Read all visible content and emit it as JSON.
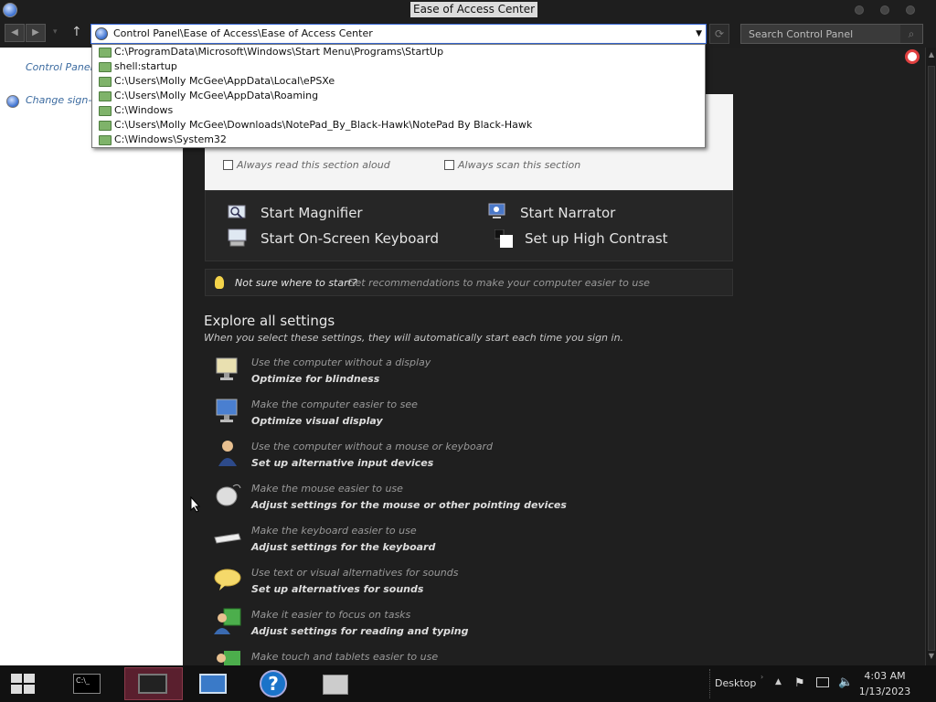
{
  "window": {
    "title": "Ease of Access Center",
    "app_icon": "control-panel-icon"
  },
  "nav": {
    "back_icon": "back-arrow-icon",
    "forward_icon": "forward-arrow-icon",
    "up_icon": "up-arrow-icon",
    "address_value": "Control Panel\\Ease of Access\\Ease of Access Center",
    "search_placeholder": "Search Control Panel"
  },
  "dropdown": {
    "items": [
      "C:\\ProgramData\\Microsoft\\Windows\\Start Menu\\Programs\\StartUp",
      "shell:startup",
      "C:\\Users\\Molly McGee\\AppData\\Local\\ePSXe",
      "C:\\Users\\Molly McGee\\AppData\\Roaming",
      "C:\\Windows",
      "C:\\Users\\Molly McGee\\Downloads\\NotePad_By_Black-Hawk\\NotePad By Black-Hawk",
      "C:\\Windows\\System32"
    ]
  },
  "sidebar": {
    "home_link": "Control Panel",
    "signin_link": "Change sign-in"
  },
  "quick_access": {
    "always_read": "Always read this section aloud",
    "always_scan": "Always scan this section"
  },
  "tools": {
    "magnifier": "Start Magnifier",
    "narrator": "Start Narrator",
    "keyboard": "Start On-Screen Keyboard",
    "contrast": "Set up High Contrast"
  },
  "hint": {
    "question": "Not sure where to start?",
    "link": "Get recommendations to make your computer easier to use"
  },
  "explore": {
    "heading": "Explore all settings",
    "subheading": "When you select these settings, they will automatically start each time you sign in.",
    "items": [
      {
        "desc": "Use the computer without a display",
        "link": "Optimize for blindness",
        "icon": "monitor-speech-icon"
      },
      {
        "desc": "Make the computer easier to see",
        "link": "Optimize visual display",
        "icon": "monitor-icon"
      },
      {
        "desc": "Use the computer without a mouse or keyboard",
        "link": "Set up alternative input devices",
        "icon": "person-headset-icon"
      },
      {
        "desc": "Make the mouse easier to use",
        "link": "Adjust settings for the mouse or other pointing devices",
        "icon": "mouse-icon"
      },
      {
        "desc": "Make the keyboard easier to use",
        "link": "Adjust settings for the keyboard",
        "icon": "keyboard-icon"
      },
      {
        "desc": "Use text or visual alternatives for sounds",
        "link": "Set up alternatives for sounds",
        "icon": "speech-bubble-icon"
      },
      {
        "desc": "Make it easier to focus on tasks",
        "link": "Adjust settings for reading and typing",
        "icon": "person-window-icon"
      },
      {
        "desc": "Make touch and tablets easier to use",
        "link": "",
        "icon": "tablet-icon"
      }
    ]
  },
  "taskbar": {
    "desktop_label": "Desktop",
    "time": "4:03 AM",
    "date": "1/13/2023"
  }
}
